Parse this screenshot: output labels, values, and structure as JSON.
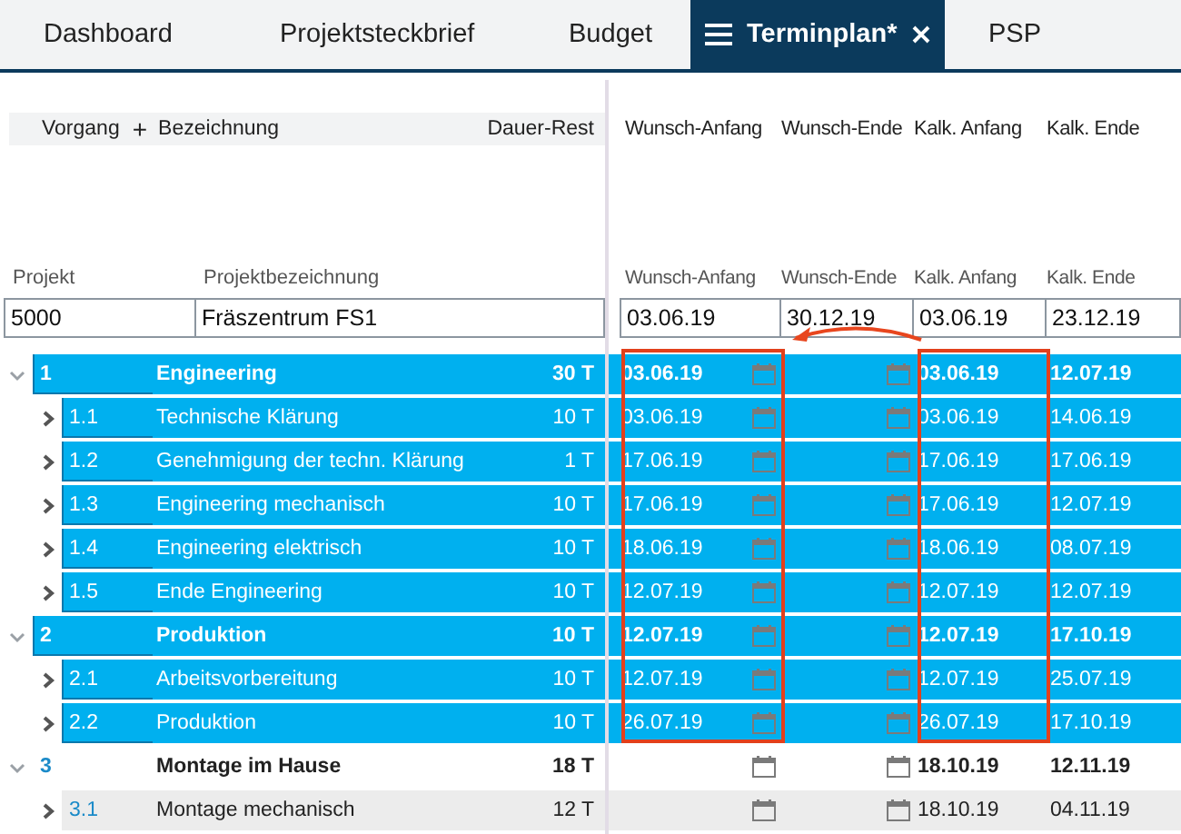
{
  "tabs": [
    {
      "label": "Dashboard",
      "selected": false,
      "menu": false,
      "closable": false
    },
    {
      "label": "Projektsteckbrief",
      "selected": false,
      "menu": false,
      "closable": false
    },
    {
      "label": "Budget",
      "selected": false,
      "menu": false,
      "closable": false
    },
    {
      "label": "Terminplan*",
      "selected": true,
      "menu": true,
      "closable": true
    },
    {
      "label": "PSP",
      "selected": false,
      "menu": false,
      "closable": false
    }
  ],
  "task_header": {
    "vorgang": "Vorgang",
    "add": "+",
    "bezeichnung": "Bezeichnung",
    "dauer": "Dauer-Rest"
  },
  "date_columns": [
    {
      "label": "Wunsch-Anfang",
      "highlighted": true
    },
    {
      "label": "Wunsch-Ende",
      "highlighted": false
    },
    {
      "label": "Kalk. Anfang",
      "highlighted": true
    },
    {
      "label": "Kalk. Ende",
      "highlighted": false
    }
  ],
  "project_columns": [
    "Projekt",
    "Projektbezeichnung"
  ],
  "project": {
    "nummer": "5000",
    "bezeichnung": "Fräszentrum FS1"
  },
  "project_date_columns": [
    "Wunsch-Anfang",
    "Wunsch-Ende",
    "Kalk. Anfang",
    "Kalk. Ende"
  ],
  "project_dates": [
    "03.06.19",
    "30.12.19",
    "03.06.19",
    "23.12.19"
  ],
  "rows": [
    {
      "nr": "1",
      "name": "Engineering",
      "dauer": "30 T",
      "wunsch_anfang": "03.06.19",
      "kalk_anfang": "03.06.19",
      "kalk_ende": "12.07.19",
      "selected": true,
      "hovered": false,
      "expanded": true,
      "children": [
        {
          "nr": "1.1",
          "name": "Technische Klärung",
          "dauer": "10 T",
          "wunsch_anfang": "03.06.19",
          "kalk_anfang": "03.06.19",
          "kalk_ende": "14.06.19",
          "selected": true,
          "hovered": false,
          "expanded": false
        },
        {
          "nr": "1.2",
          "name": "Genehmigung der techn. Klärung",
          "dauer": "1 T",
          "wunsch_anfang": "17.06.19",
          "kalk_anfang": "17.06.19",
          "kalk_ende": "17.06.19",
          "selected": true,
          "hovered": false,
          "expanded": false
        },
        {
          "nr": "1.3",
          "name": "Engineering mechanisch",
          "dauer": "10 T",
          "wunsch_anfang": "17.06.19",
          "kalk_anfang": "17.06.19",
          "kalk_ende": "12.07.19",
          "selected": true,
          "hovered": false,
          "expanded": false
        },
        {
          "nr": "1.4",
          "name": "Engineering elektrisch",
          "dauer": "10 T",
          "wunsch_anfang": "18.06.19",
          "kalk_anfang": "18.06.19",
          "kalk_ende": "08.07.19",
          "selected": true,
          "hovered": false,
          "expanded": false
        },
        {
          "nr": "1.5",
          "name": "Ende Engineering",
          "dauer": "10 T",
          "wunsch_anfang": "12.07.19",
          "kalk_anfang": "12.07.19",
          "kalk_ende": "12.07.19",
          "selected": true,
          "hovered": false,
          "expanded": false
        }
      ]
    },
    {
      "nr": "2",
      "name": "Produktion",
      "dauer": "10 T",
      "wunsch_anfang": "12.07.19",
      "kalk_anfang": "12.07.19",
      "kalk_ende": "17.10.19",
      "selected": true,
      "hovered": false,
      "expanded": true,
      "children": [
        {
          "nr": "2.1",
          "name": "Arbeitsvorbereitung",
          "dauer": "10 T",
          "wunsch_anfang": "12.07.19",
          "kalk_anfang": "12.07.19",
          "kalk_ende": "25.07.19",
          "selected": true,
          "hovered": false,
          "expanded": false
        },
        {
          "nr": "2.2",
          "name": "Produktion",
          "dauer": "10 T",
          "wunsch_anfang": "26.07.19",
          "kalk_anfang": "26.07.19",
          "kalk_ende": "17.10.19",
          "selected": true,
          "hovered": false,
          "expanded": false
        }
      ]
    },
    {
      "nr": "3",
      "name": "Montage im Hause",
      "dauer": "18 T",
      "kalk_anfang": "18.10.19",
      "kalk_ende": "12.11.19",
      "selected": false,
      "hovered": false,
      "expanded": true,
      "children": [
        {
          "nr": "3.1",
          "name": "Montage mechanisch",
          "dauer": "12 T",
          "kalk_anfang": "18.10.19",
          "kalk_ende": "04.11.19",
          "selected": false,
          "hovered": true,
          "expanded": false
        }
      ]
    }
  ]
}
